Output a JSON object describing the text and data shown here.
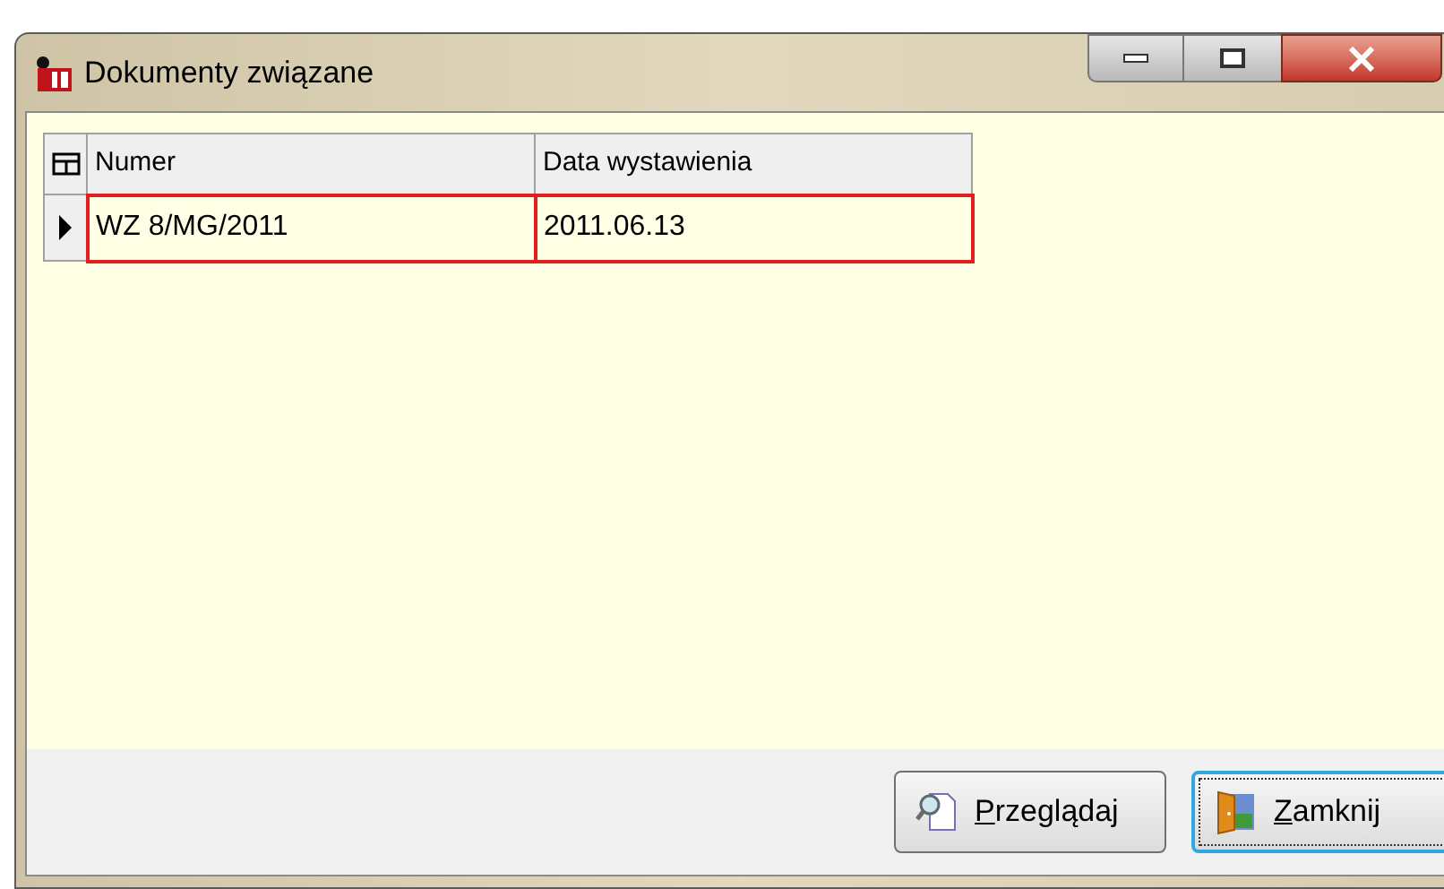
{
  "window": {
    "title": "Dokumenty związane"
  },
  "table": {
    "columns": [
      "Numer",
      "Data wystawienia"
    ],
    "rows": [
      {
        "cells": [
          "WZ 8/MG/2011",
          "2011.06.13"
        ],
        "selected": true
      }
    ]
  },
  "buttons": [
    {
      "label": "Przeglądaj",
      "kind": "preview",
      "focused": false
    },
    {
      "label": "Zamknij",
      "kind": "close",
      "focused": true
    }
  ]
}
